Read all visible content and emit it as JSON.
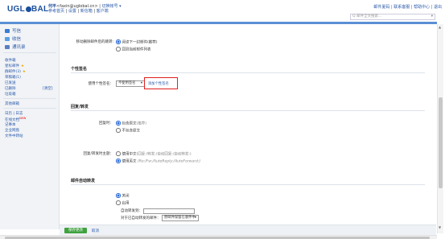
{
  "header": {
    "logo": "UGLOBAL",
    "account_name": "何平",
    "account_email": "<faxin@uglobal.cn>",
    "switch_account": "切换帐号 ▾",
    "links": [
      "参考首页",
      "设置",
      "新信箱",
      "客户端"
    ],
    "top_links": "邮件夏码 | 联系客服 | 帮助中心 | 退出",
    "search_placeholder": "Q 邮件全文搜索..."
  },
  "sidebar": {
    "main": [
      {
        "label": "写信",
        "icon": "compose-icon",
        "color": "#3a7bd5"
      },
      {
        "label": "收信",
        "icon": "inbox-icon",
        "color": "#5aa0e0"
      },
      {
        "label": "通讯录",
        "icon": "contacts-icon",
        "color": "#5a7fc0"
      }
    ],
    "folders": [
      {
        "label": "收件箱",
        "star": false
      },
      {
        "label": "星标邮件",
        "star": true
      },
      {
        "label": "群邮件(3)",
        "star": true
      },
      {
        "label": "草稿箱(1)",
        "star": false
      },
      {
        "label": "已发送",
        "star": false
      },
      {
        "label": "已删除",
        "star": false,
        "right": "[清空]"
      },
      {
        "label": "垃圾箱",
        "star": false
      }
    ],
    "other_header": "其他邮箱",
    "tools": [
      {
        "label": "日历 | 日志",
        "new": false
      },
      {
        "label": "在线文档",
        "new": true
      },
      {
        "label": "记事本",
        "new": false
      },
      {
        "label": "企业网盘",
        "new": false
      },
      {
        "label": "文件中转站",
        "new": false
      }
    ],
    "new_badge": "NEW"
  },
  "settings": {
    "delete_after": {
      "label": "移动删除邮件后的跳转:",
      "options": [
        "阅读下一封邮件(推荐)",
        "回到当前邮件列表"
      ],
      "selected": 0
    },
    "signature": {
      "title": "个性签名",
      "label": "使用个性签名：",
      "select_value": "不使用签名",
      "add_link": "添加个性签名"
    },
    "reply": {
      "title": "回复/转发",
      "reply_label": "回复时：",
      "reply_options": [
        "包含原文",
        "(推荐)",
        "不包含原文"
      ],
      "reply_selected": 0,
      "subject_label": "回复/转发时主题：",
      "subject_options": [
        {
          "text": "使用中文",
          "hint": "(回复:/转发:/自动回复:/自动转发:)"
        },
        {
          "text": "使用英文",
          "hint": "(Re:/Fw:/AutoReply:/AutoForward:)"
        }
      ],
      "subject_selected": 1
    },
    "auto_forward": {
      "title": "邮件自动转发",
      "options": [
        "关闭",
        "启用"
      ],
      "selected": 0,
      "address_label": "自动转发到：",
      "after_label": "对于已自动转发的邮件：",
      "after_value": "原邮件保留在收件中"
    }
  },
  "footer": {
    "save": "保存更改",
    "cancel": "取消"
  },
  "colors": {
    "brand": "#1b4f9c",
    "save_green": "#3fa23f",
    "highlight_red": "#e02020"
  }
}
